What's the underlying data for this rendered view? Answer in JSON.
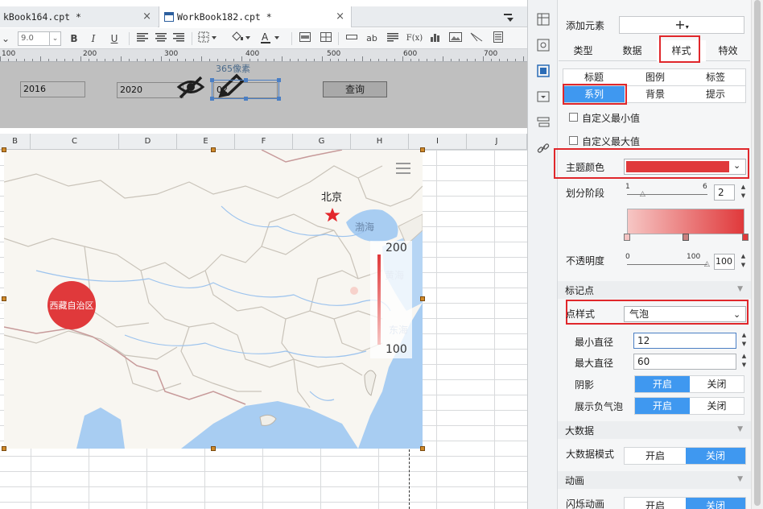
{
  "tabs": [
    {
      "label": "kBook164.cpt *",
      "close": "×"
    },
    {
      "label": "WorkBook182.cpt *",
      "close": "×"
    }
  ],
  "toolbar": {
    "font_size": "9.0",
    "bold": "B",
    "italic": "I",
    "underline": "U",
    "text_tool": "ab",
    "formula": "F(x)"
  },
  "ruler": {
    "marks": [
      "100",
      "200",
      "300",
      "400",
      "500",
      "600",
      "700"
    ]
  },
  "params": {
    "start_year": "2016",
    "end_year": "2020",
    "field_value": "02",
    "px_label": "365像素",
    "query_label": "查询"
  },
  "columns": [
    "B",
    "C",
    "D",
    "E",
    "F",
    "G",
    "H",
    "I",
    "J"
  ],
  "map": {
    "city_label": "北京",
    "sea_label": "渤海",
    "sea_label_2": "黄海",
    "sea_label_3": "东海",
    "region_label": "西藏自治区",
    "legend_max": "200",
    "legend_min": "100",
    "star_color": "#e3262b",
    "bubble_color": "#e0393b",
    "water_color": "#a8cdf2"
  },
  "panel": {
    "add_element_label": "添加元素",
    "add_symbol": "+",
    "main_tabs": [
      {
        "label": "类型",
        "active": false
      },
      {
        "label": "数据",
        "active": false
      },
      {
        "label": "样式",
        "active": true
      },
      {
        "label": "特效",
        "active": false
      }
    ],
    "sub_tabs_row1": [
      "标题",
      "图例",
      "标签"
    ],
    "sub_tabs_row2": [
      {
        "label": "系列",
        "active": true
      },
      {
        "label": "背景",
        "active": false
      },
      {
        "label": "提示",
        "active": false
      }
    ],
    "custom_min": "自定义最小值",
    "custom_max": "自定义最大值",
    "theme_color_label": "主题颜色",
    "theme_color": "#e0393b",
    "stages_label": "划分阶段",
    "stages_min": "1",
    "stages_max": "6",
    "stages_value": "2",
    "opacity_label": "不透明度",
    "opacity_min": "0",
    "opacity_max": "100",
    "opacity_value": "100",
    "marker_section": "标记点",
    "point_style_label": "点样式",
    "point_style_value": "气泡",
    "min_diameter_label": "最小直径",
    "min_diameter_value": "12",
    "max_diameter_label": "最大直径",
    "max_diameter_value": "60",
    "shadow_label": "阴影",
    "show_negative_label": "展示负气泡",
    "on_label": "开启",
    "off_label": "关闭",
    "bigdata_section": "大数据",
    "bigdata_mode_label": "大数据模式",
    "animation_section": "动画",
    "flash_animation_label": "闪烁动画"
  }
}
